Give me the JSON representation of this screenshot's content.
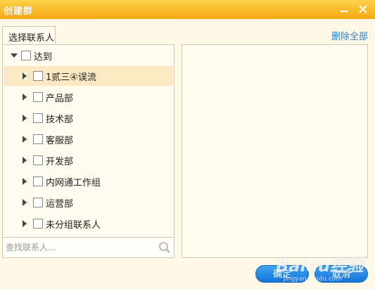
{
  "window": {
    "title": "创建群"
  },
  "tabs": [
    {
      "label": "选择联系人"
    }
  ],
  "header": {
    "delete_all": "删除全部"
  },
  "tree": {
    "root": {
      "label": "达到",
      "expanded": true,
      "checked": false
    },
    "children": [
      {
        "label": "1贰三④误流",
        "selected": true,
        "checked": false
      },
      {
        "label": "产品部",
        "checked": false
      },
      {
        "label": "技术部",
        "checked": false
      },
      {
        "label": "客服部",
        "checked": false
      },
      {
        "label": "开发部",
        "checked": false
      },
      {
        "label": "内网通工作组",
        "checked": false
      },
      {
        "label": "运营部",
        "checked": false
      },
      {
        "label": "未分组联系人",
        "checked": false
      }
    ]
  },
  "search": {
    "placeholder": "查找联系人...",
    "value": ""
  },
  "buttons": {
    "ok": "确定",
    "cancel": "取消"
  },
  "watermark": {
    "text": "Baidu经验",
    "url_text": "jingyan.baidu.com"
  },
  "colors": {
    "titlebar": "#f5a811",
    "accent_blue": "#1473d8",
    "link": "#2f7fc6",
    "selected_row": "#fbe9c3",
    "panel_bg": "#fffbef"
  }
}
